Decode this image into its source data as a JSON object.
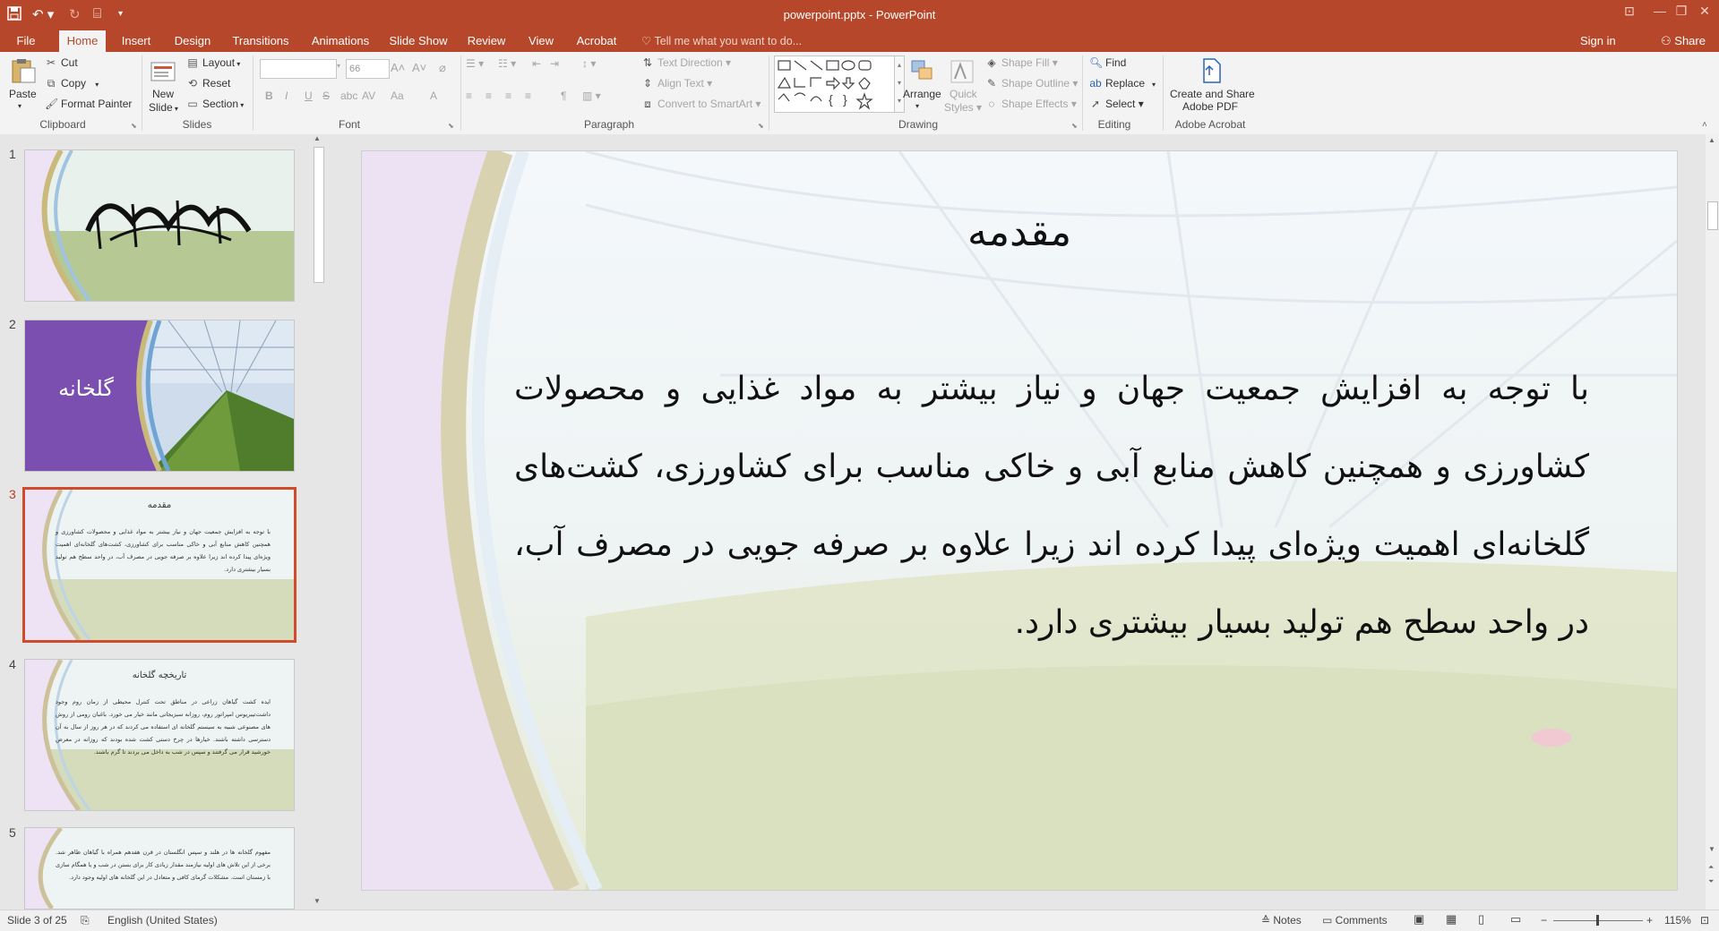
{
  "window": {
    "title": "powerpoint.pptx - PowerPoint"
  },
  "quick_access": {
    "save_icon": "save-icon",
    "undo_icon": "undo-icon",
    "redo_icon": "redo-icon",
    "customize_icon": "customize-icon"
  },
  "tabs": [
    "File",
    "Home",
    "Insert",
    "Design",
    "Transitions",
    "Animations",
    "Slide Show",
    "Review",
    "View",
    "Acrobat"
  ],
  "active_tab": "Home",
  "tell_me": "Tell me what you want to do...",
  "account": {
    "sign_in": "Sign in",
    "share": "Share"
  },
  "ribbon": {
    "clipboard": {
      "label": "Clipboard",
      "paste": "Paste",
      "cut": "Cut",
      "copy": "Copy",
      "format_painter": "Format Painter"
    },
    "slides": {
      "label": "Slides",
      "new_slide": "New",
      "new_slide_2": "Slide",
      "layout": "Layout",
      "reset": "Reset",
      "section": "Section"
    },
    "font": {
      "label": "Font",
      "font_name": "",
      "font_size": "66",
      "bold": "B",
      "italic": "I",
      "underline": "U",
      "strike": "S",
      "spacing": "AV",
      "case": "Aa",
      "color": "A"
    },
    "paragraph": {
      "label": "Paragraph",
      "text_direction": "Text Direction",
      "align_text": "Align Text",
      "convert_smartart": "Convert to SmartArt"
    },
    "drawing": {
      "label": "Drawing",
      "arrange": "Arrange",
      "quick_styles": "Quick",
      "quick_styles_2": "Styles",
      "shape_fill": "Shape Fill",
      "shape_outline": "Shape Outline",
      "shape_effects": "Shape Effects"
    },
    "editing": {
      "label": "Editing",
      "find": "Find",
      "replace": "Replace",
      "select": "Select"
    },
    "acrobat": {
      "label": "Adobe Acrobat",
      "create_share": "Create and Share",
      "create_share_2": "Adobe PDF"
    }
  },
  "thumbnails": [
    {
      "num": "1",
      "title": ""
    },
    {
      "num": "2",
      "title": "گلخانه"
    },
    {
      "num": "3",
      "title": "مقدمه",
      "body": "با توجه به افزایش جمعیت جهان و نیاز بیشتر به مواد غذایی و محصولات کشاورزی و همچنین کاهش منابع آبی و خاکی مناسب برای کشاورزی، کشت‌های گلخانه‌ای اهمیت ویژه‌ای پیدا کرده اند زیرا علاوه بر صرفه جویی در مصرف آب، در واحد سطح هم تولید بسیار بیشتری دارد."
    },
    {
      "num": "4",
      "title": "تاریخچه گلخانه",
      "body": "ایده کشت گیاهان زراعی در مناطق تحت کنترل محیطی از زمان روم وجود داشت‌تیبریوس امپراتور روم، روزانه سبزیجاتی مانند خیار می خورد. باغبان رومی از روش های مصنوعی شبیه به سیستم گلخانه ای استفاده می کردند که در هر روز از سال به آن دسترسی داشته باشند. خیارها در چرخ دستی کشت شده بودند که روزانه در معرض خورشید قرار می گرفتند و سپس در شب به داخل می بردند تا گرم باشند."
    },
    {
      "num": "5",
      "title": "",
      "body": "مفهوم گلخانه ها در هلند و سپس انگلستان در قرن هفدهم همراه با گیاهان ظاهر شد. برخی از این تلاش های اولیه نیازمند مقدار زیادی کار برای بستن در شب و یا همگام سازی با زمستان است. مشکلات گرمای کافی و متعادل در این گلخانه های اولیه وجود دارد."
    }
  ],
  "slide": {
    "title": "مقدمه",
    "body": "با توجه به افزایش جمعیت جهان و نیاز بیشتر به مواد غذایی و محصولات کشاورزی و همچنین کاهش منابع آبی و خاکی مناسب برای کشاورزی، کشت‌های گلخانه‌ای اهمیت ویژه‌ای پیدا کرده اند زیرا علاوه بر صرفه جویی در مصرف آب، در واحد سطح هم تولید بسیار بیشتری دارد."
  },
  "status": {
    "slide_info": "Slide 3 of 25",
    "language": "English (United States)",
    "notes": "Notes",
    "comments": "Comments",
    "zoom": "115%"
  },
  "colors": {
    "accent": "#b7472a",
    "slide2_purple": "#7a4fb0"
  }
}
